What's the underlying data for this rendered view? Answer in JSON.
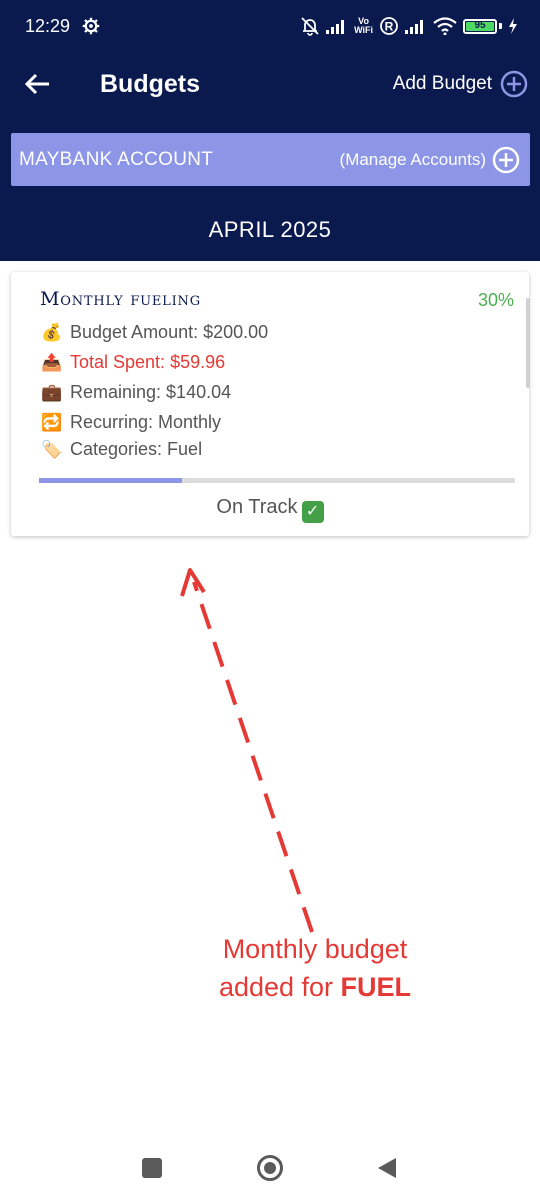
{
  "status_bar": {
    "time": "12:29",
    "network_label_top": "Vo",
    "network_label_bottom": "WiFi",
    "battery_level": "95"
  },
  "app_bar": {
    "title": "Budgets",
    "add_budget_label": "Add Budget"
  },
  "account": {
    "name": "MAYBANK ACCOUNT",
    "manage_label": "(Manage Accounts)"
  },
  "period": {
    "month": "APRIL 2025"
  },
  "budget_card": {
    "title": "Monthly fueling",
    "percent_label": "30%",
    "budget_amount": "Budget Amount: $200.00",
    "total_spent": "Total Spent: $59.96",
    "remaining": "Remaining: $140.04",
    "recurring": "Recurring: Monthly",
    "categories": "Categories: Fuel",
    "progress_fraction": 0.3,
    "status": "On Track"
  },
  "annotation": {
    "line1": "Monthly budget",
    "line2_prefix": "added for ",
    "line2_bold": "FUEL"
  },
  "colors": {
    "header_bg": "#0b1a4e",
    "account_bar": "#8c95e6",
    "percent": "#4caf50",
    "spent": "#e53935",
    "annotation": "#e53935"
  },
  "icons": {
    "back": "arrow-left-icon",
    "add": "plus-circle-icon",
    "money_bag": "💰",
    "outbox": "📤",
    "briefcase": "💼",
    "repeat": "🔁",
    "tag": "🏷️"
  }
}
